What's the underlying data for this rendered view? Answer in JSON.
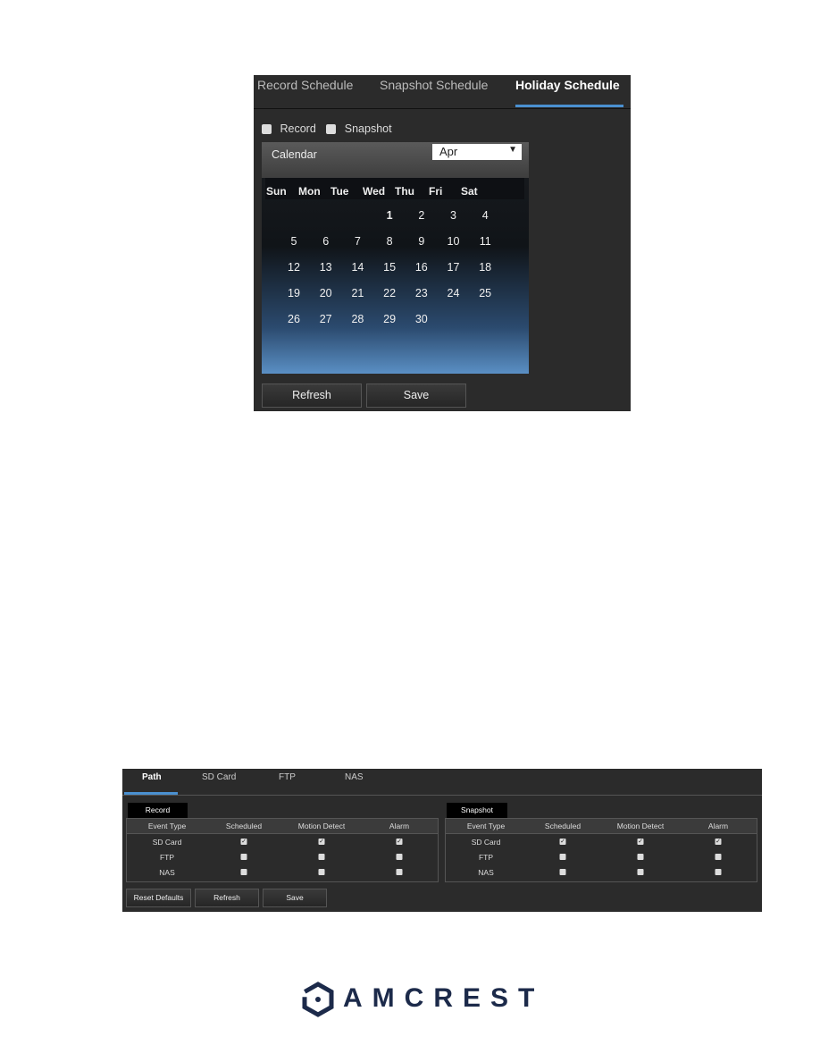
{
  "holiday_panel": {
    "tabs": [
      "Record Schedule",
      "Snapshot Schedule",
      "Holiday Schedule"
    ],
    "active_tab": "Holiday Schedule",
    "checkboxes": [
      {
        "label": "Record",
        "checked": false
      },
      {
        "label": "Snapshot",
        "checked": false
      }
    ],
    "calendar_label": "Calendar",
    "month": "Apr",
    "weekdays": [
      "Sun",
      "Mon",
      "Tue",
      "Wed",
      "Thu",
      "Fri",
      "Sat"
    ],
    "days": [
      "1",
      "2",
      "3",
      "4",
      "5",
      "6",
      "7",
      "8",
      "9",
      "10",
      "11",
      "12",
      "13",
      "14",
      "15",
      "16",
      "17",
      "18",
      "19",
      "20",
      "21",
      "22",
      "23",
      "24",
      "25",
      "26",
      "27",
      "28",
      "29",
      "30"
    ],
    "buttons": {
      "refresh": "Refresh",
      "save": "Save"
    },
    "accent": "#4a90d0"
  },
  "path_panel": {
    "tabs": [
      "Path",
      "SD Card",
      "FTP",
      "NAS"
    ],
    "active_tab": "Path",
    "tables": [
      {
        "title": "Record",
        "columns": [
          "Event Type",
          "Scheduled",
          "Motion Detect",
          "Alarm"
        ],
        "rows": [
          {
            "type": "SD Card",
            "checks": [
              true,
              true,
              true
            ]
          },
          {
            "type": "FTP",
            "checks": [
              false,
              false,
              false
            ]
          },
          {
            "type": "NAS",
            "checks": [
              false,
              false,
              false
            ]
          }
        ]
      },
      {
        "title": "Snapshot",
        "columns": [
          "Event Type",
          "Scheduled",
          "Motion Detect",
          "Alarm"
        ],
        "rows": [
          {
            "type": "SD Card",
            "checks": [
              true,
              true,
              true
            ]
          },
          {
            "type": "FTP",
            "checks": [
              false,
              false,
              false
            ]
          },
          {
            "type": "NAS",
            "checks": [
              false,
              false,
              false
            ]
          }
        ]
      }
    ],
    "buttons": {
      "reset": "Reset Defaults",
      "refresh": "Refresh",
      "save": "Save"
    }
  },
  "logo": {
    "text": "AMCREST",
    "color": "#1c2a4a"
  }
}
